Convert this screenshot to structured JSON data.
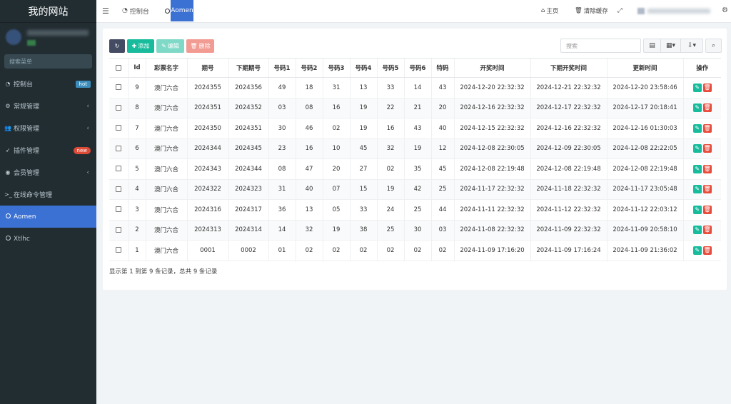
{
  "sidebar": {
    "logo": "我的网站",
    "search_placeholder": "搜索菜单",
    "items": [
      {
        "label": "控制台",
        "icon": "dashboard-icon",
        "glyph": "◔",
        "badge": "hot",
        "chevron": ""
      },
      {
        "label": "常规管理",
        "icon": "cogs-icon",
        "glyph": "⚙",
        "badge": "",
        "chevron": "‹"
      },
      {
        "label": "权限管理",
        "icon": "users-icon",
        "glyph": "👥",
        "badge": "",
        "chevron": "‹"
      },
      {
        "label": "插件管理",
        "icon": "rocket-icon",
        "glyph": "➶",
        "badge": "new",
        "chevron": ""
      },
      {
        "label": "会员管理",
        "icon": "user-icon",
        "glyph": "◉",
        "badge": "",
        "chevron": "‹"
      },
      {
        "label": "在线命令管理",
        "icon": "terminal-icon",
        "glyph": ">_",
        "badge": "",
        "chevron": ""
      },
      {
        "label": "Aomen",
        "icon": "circle-icon",
        "glyph": "",
        "badge": "",
        "chevron": ""
      },
      {
        "label": "Xtlhc",
        "icon": "circle-icon",
        "glyph": "",
        "badge": "",
        "chevron": ""
      }
    ]
  },
  "header": {
    "tabs": [
      {
        "label": "控制台"
      },
      {
        "label": "Aomen"
      }
    ],
    "home_label": "主页",
    "clear_cache_label": "清除缓存"
  },
  "toolbar": {
    "add_label": "添加",
    "edit_label": "编辑",
    "delete_label": "删除",
    "search_placeholder": "搜索"
  },
  "table": {
    "columns": [
      "",
      "Id",
      "彩票名字",
      "期号",
      "下期期号",
      "号码1",
      "号码2",
      "号码3",
      "号码4",
      "号码5",
      "号码6",
      "特码",
      "开奖时间",
      "下期开奖时间",
      "更新时间",
      "操作"
    ],
    "rows": [
      [
        "9",
        "澳门六合",
        "2024355",
        "2024356",
        "49",
        "18",
        "31",
        "13",
        "33",
        "14",
        "43",
        "2024-12-20 22:32:32",
        "2024-12-21 22:32:32",
        "2024-12-20 23:58:46"
      ],
      [
        "8",
        "澳门六合",
        "2024351",
        "2024352",
        "03",
        "08",
        "16",
        "19",
        "22",
        "21",
        "20",
        "2024-12-16 22:32:32",
        "2024-12-17 22:32:32",
        "2024-12-17 20:18:41"
      ],
      [
        "7",
        "澳门六合",
        "2024350",
        "2024351",
        "30",
        "46",
        "02",
        "19",
        "16",
        "43",
        "40",
        "2024-12-15 22:32:32",
        "2024-12-16 22:32:32",
        "2024-12-16 01:30:03"
      ],
      [
        "6",
        "澳门六合",
        "2024344",
        "2024345",
        "23",
        "16",
        "10",
        "45",
        "32",
        "19",
        "12",
        "2024-12-08 22:30:05",
        "2024-12-09 22:30:05",
        "2024-12-08 22:22:05"
      ],
      [
        "5",
        "澳门六合",
        "2024343",
        "2024344",
        "08",
        "47",
        "20",
        "27",
        "02",
        "35",
        "45",
        "2024-12-08 22:19:48",
        "2024-12-08 22:19:48",
        "2024-12-08 22:19:48"
      ],
      [
        "4",
        "澳门六合",
        "2024322",
        "2024323",
        "31",
        "40",
        "07",
        "15",
        "19",
        "42",
        "25",
        "2024-11-17 22:32:32",
        "2024-11-18 22:32:32",
        "2024-11-17 23:05:48"
      ],
      [
        "3",
        "澳门六合",
        "2024316",
        "2024317",
        "36",
        "13",
        "05",
        "33",
        "24",
        "25",
        "44",
        "2024-11-11 22:32:32",
        "2024-11-12 22:32:32",
        "2024-11-12 22:03:12"
      ],
      [
        "2",
        "澳门六合",
        "2024313",
        "2024314",
        "14",
        "32",
        "19",
        "38",
        "25",
        "30",
        "03",
        "2024-11-08 22:32:32",
        "2024-11-09 22:32:32",
        "2024-11-09 20:58:10"
      ],
      [
        "1",
        "澳门六合",
        "0001",
        "0002",
        "01",
        "02",
        "02",
        "02",
        "02",
        "02",
        "02",
        "2024-11-09 17:16:20",
        "2024-11-09 17:16:24",
        "2024-11-09 21:36:02"
      ]
    ],
    "footer": "显示第 1 到第 9 条记录，总共 9 条记录"
  },
  "colors": {
    "sidebar_bg": "#222d32",
    "accent": "#3c71d4",
    "success": "#18bc9c",
    "danger": "#e74c3c"
  }
}
